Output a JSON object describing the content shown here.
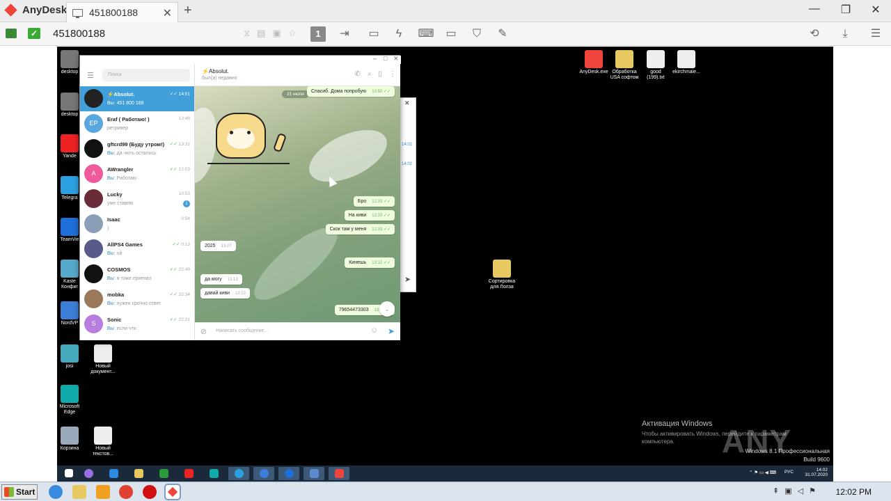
{
  "anydesk": {
    "app_name": "AnyDesk",
    "tab_label": "451800188",
    "address": "451800188",
    "display_number": "1"
  },
  "desktop_icons_left": [
    {
      "label": "desktop",
      "color": "#777"
    },
    {
      "label": "desktop",
      "color": "#777"
    },
    {
      "label": "Yande",
      "color": "#e22"
    },
    {
      "label": "Telegra",
      "color": "#2ba0e0"
    },
    {
      "label": "TeamVie",
      "color": "#1e6fd8"
    },
    {
      "label": "Kaste\nКонфиг",
      "color": "#5ac"
    },
    {
      "label": "NordVP",
      "color": "#3c7fd9"
    },
    {
      "label": "josi",
      "color": "#4ab"
    },
    {
      "label": "Microsoft\nEdge",
      "color": "#1aa"
    },
    {
      "label": "Корзина",
      "color": "#9ab"
    }
  ],
  "desktop_icons_mid": [
    {
      "label": "Новый\nдокумент...",
      "color": "#eee"
    },
    {
      "label": "Новый\nтекстов...",
      "color": "#eee"
    }
  ],
  "desktop_icons_right": [
    {
      "label": "AnyDesk.exe",
      "color": "#ef443b"
    },
    {
      "label": "Обработка\nUSA софтом",
      "color": "#e8c860"
    },
    {
      "label": "good\n(199).txt",
      "color": "#eee"
    },
    {
      "label": "ekirchmaie...",
      "color": "#eee"
    }
  ],
  "desktop_folder_center": {
    "label": "Сортировка\nдля Лолза",
    "color": "#e8c860"
  },
  "telegram": {
    "search_placeholder": "Поиск",
    "chat_title": "⚡Absolut.",
    "chat_status": "был(а) недавно",
    "input_placeholder": "Написать сообщение...",
    "date_pill": "31 июля",
    "chats": [
      {
        "name": "⚡Absolut.",
        "preview_you": "Вы:",
        "preview": "451 800 188",
        "time": "14:01",
        "read": true,
        "initials": "",
        "color": "#222",
        "active": true,
        "unread": ""
      },
      {
        "name": "Eraf ( Работаю! )",
        "preview_you": "",
        "preview": "ретривер",
        "time": "13:48",
        "read": false,
        "initials": "EP",
        "color": "#5aa7e0",
        "active": false,
        "unread": ""
      },
      {
        "name": "gftcrd99 (Буду утром!)",
        "preview_you": "Вы:",
        "preview": "да чють осталось",
        "time": "13:31",
        "read": true,
        "initials": "",
        "color": "#111",
        "active": false,
        "unread": ""
      },
      {
        "name": "AWrangler",
        "preview_you": "Вы:",
        "preview": "Работаю",
        "time": "12:03",
        "read": true,
        "initials": "A",
        "color": "#ee5a9a",
        "active": false,
        "unread": ""
      },
      {
        "name": "Lucky",
        "preview_you": "",
        "preview": "уже ставлю",
        "time": "10:53",
        "read": false,
        "initials": "",
        "color": "#6b2c3a",
        "active": false,
        "unread": "1"
      },
      {
        "name": "Isaac",
        "preview_you": "",
        "preview": ")",
        "time": "0:54",
        "read": false,
        "initials": "",
        "color": "#8aa0b8",
        "active": false,
        "unread": ""
      },
      {
        "name": "AllPS4 Games",
        "preview_you": "Вы:",
        "preview": "ой",
        "time": "0:13",
        "read": true,
        "initials": "",
        "color": "#5a5a8a",
        "active": false,
        "unread": ""
      },
      {
        "name": "COSMOS",
        "preview_you": "Вы:",
        "preview": "я тоже приехал",
        "time": "22:49",
        "read": true,
        "initials": "",
        "color": "#111",
        "active": false,
        "unread": ""
      },
      {
        "name": "mobka",
        "preview_you": "Вы:",
        "preview": "нужен срочно ответ",
        "time": "22:34",
        "read": true,
        "initials": "",
        "color": "#9a7a5a",
        "active": false,
        "unread": ""
      },
      {
        "name": "Sonic",
        "preview_you": "Вы:",
        "preview": "если что",
        "time": "22:21",
        "read": true,
        "initials": "S",
        "color": "#b77ee0",
        "active": false,
        "unread": ""
      }
    ],
    "messages": [
      {
        "text": "Спасиб. Дома попробую",
        "time": "10:50",
        "out": true
      },
      {
        "text": "Бро",
        "time": "12:33",
        "out": true
      },
      {
        "text": "На киви",
        "time": "12:33",
        "out": true
      },
      {
        "text": "Скок там у меня",
        "time": "12:33",
        "out": true
      },
      {
        "text": "2025",
        "time": "13:07",
        "out": false
      },
      {
        "text": "Кинешь",
        "time": "13:12",
        "out": true
      },
      {
        "text": "да могу",
        "time": "13:13",
        "out": false
      },
      {
        "text": "давай киви",
        "time": "13:13",
        "out": false
      },
      {
        "text": "79654473303",
        "time": "13:2",
        "out": true
      }
    ]
  },
  "behind_window": {
    "times": [
      "14:02",
      "14:02"
    ]
  },
  "remote_tray": {
    "lang": "РУС",
    "time": "14:02",
    "date": "31.07.2020"
  },
  "watermark": {
    "title": "Активация Windows",
    "text": "Чтобы активировать Windows, перейдите к параметрам\nкомпьютера.",
    "edition": "Windows 8.1 Профессиональная",
    "build": "Build 9600",
    "brand": "ANY RUN"
  },
  "local_taskbar": {
    "start_label": "Start",
    "clock": "12:02 PM"
  }
}
